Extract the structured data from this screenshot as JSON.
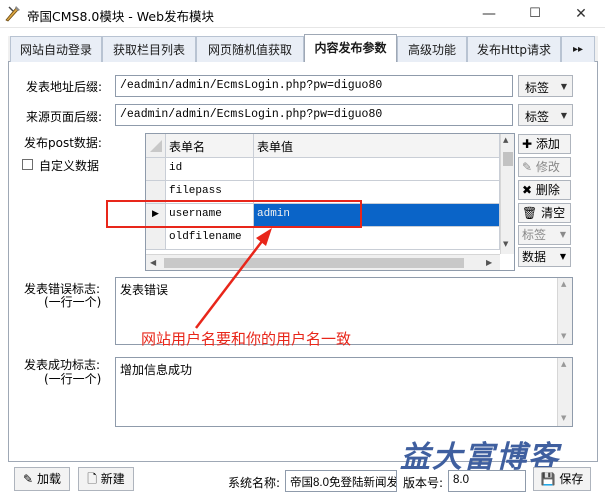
{
  "window": {
    "title": "帝国CMS8.0模块 - Web发布模块",
    "minimize": "—",
    "maximize": "☐",
    "close": "✕"
  },
  "tabs": [
    {
      "label": "网站自动登录",
      "active": false
    },
    {
      "label": "获取栏目列表",
      "active": false
    },
    {
      "label": "网页随机值获取",
      "active": false
    },
    {
      "label": "内容发布参数",
      "active": true
    },
    {
      "label": "高级功能",
      "active": false
    },
    {
      "label": "发布Http请求",
      "active": false
    }
  ],
  "tab_scroll": "▸▸",
  "publish_url": {
    "label": "发表地址后缀:",
    "value": "/eadmin/admin/EcmsLogin.php?pw=diguo80",
    "dropdown": "标签"
  },
  "referer_url": {
    "label": "来源页面后缀:",
    "value": "/eadmin/admin/EcmsLogin.php?pw=diguo80",
    "dropdown": "标签"
  },
  "post_data": {
    "label": "发布post数据:",
    "custom_checkbox_label": "自定义数据",
    "columns": [
      "表单名",
      "表单值"
    ],
    "rows": [
      {
        "name": "id",
        "value": "",
        "selected": false
      },
      {
        "name": "filepass",
        "value": "",
        "selected": false
      },
      {
        "name": "username",
        "value": "admin",
        "selected": true
      },
      {
        "name": "oldfilename",
        "value": "",
        "selected": false
      }
    ],
    "buttons": {
      "add": "添加",
      "edit": "修改",
      "delete": "删除",
      "clear": "清空",
      "tag": "标签",
      "data": "数据"
    }
  },
  "error_flag": {
    "label_line1": "发表错误标志:",
    "label_line2": "(一行一个)",
    "value": "发表错误"
  },
  "annotation": "网站用户名要和你的用户名一致",
  "success_flag": {
    "label_line1": "发表成功标志:",
    "label_line2": "(一行一个)",
    "value": "增加信息成功"
  },
  "watermark": "益大富博客",
  "footer": {
    "load_button": "加载",
    "new_button": "新建",
    "system_name_label": "系统名称:",
    "system_name_value": "帝国8.0免登陆新闻发",
    "version_label": "版本号:",
    "version_value": "8.0",
    "save_button": "保存"
  },
  "colors": {
    "annotation_red": "#e8261a",
    "selection_blue": "#0a64c8",
    "tab_border": "#9fa8b5"
  }
}
